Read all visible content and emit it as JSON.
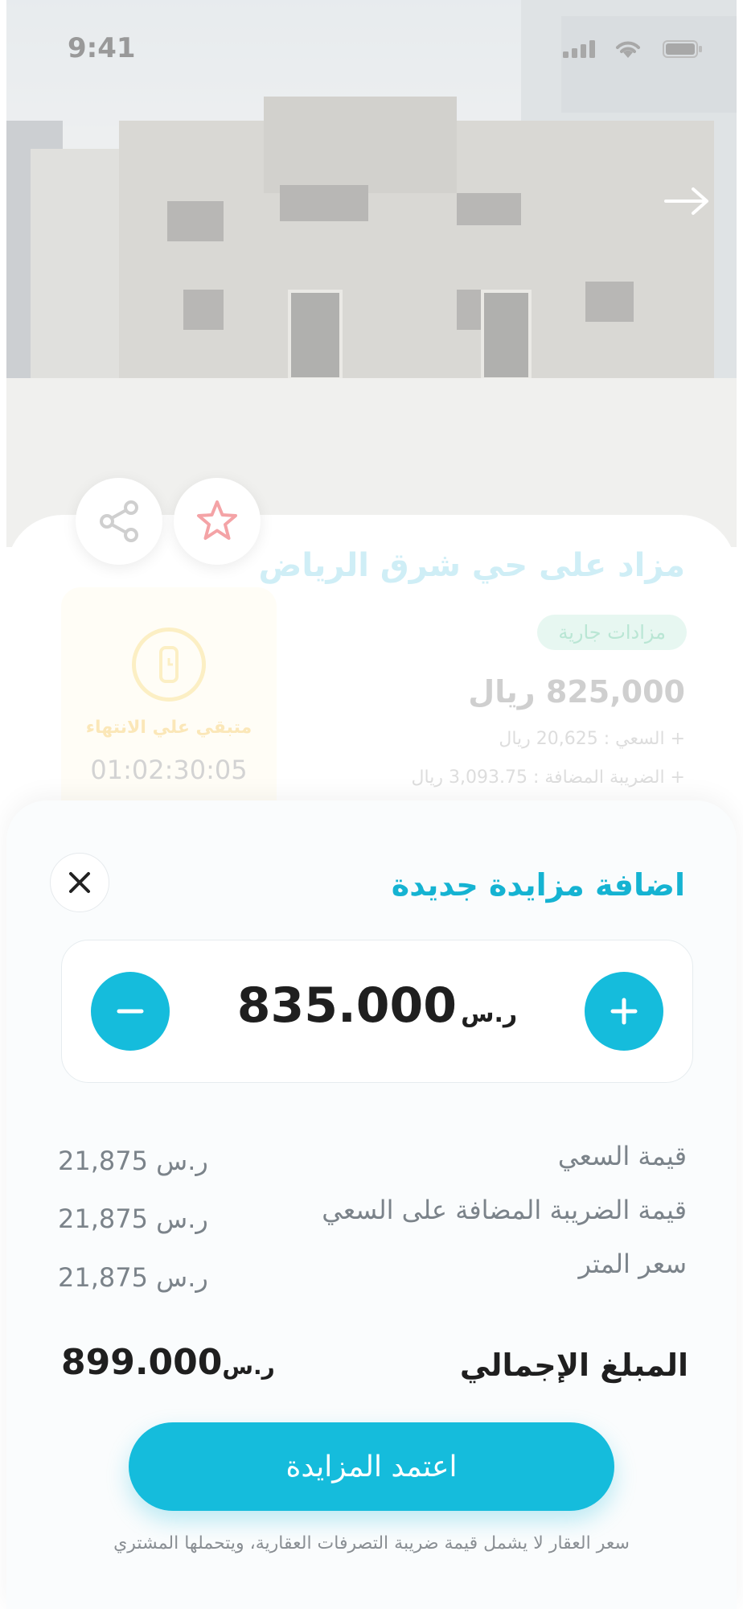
{
  "status_bar": {
    "time": "9:41"
  },
  "listing": {
    "title": "مزاد على حي شرق الرياض",
    "status": "مزادات جارية",
    "price": "825,000 ريال",
    "commission": "+ السعي : 20,625 ريال",
    "vat": "+ الضريبة المضافة : 3,093.75 ريال",
    "timer_label": "متبقي علي الانتهاء",
    "timer_value": "01:02:30:05"
  },
  "sheet": {
    "title": "اضافة مزايدة جديدة",
    "amount": "835.000",
    "currency": "ر.س",
    "rows": [
      {
        "label": "قيمة السعي",
        "value": "21,875 ر.س"
      },
      {
        "label": "قيمة الضريبة المضافة على السعي",
        "value": "21,875 ر.س"
      },
      {
        "label": "سعر المتر",
        "value": "21,875 ر.س"
      }
    ],
    "total_label": "المبلغ الإجمالي",
    "total_value": "899.000",
    "total_currency": "ر.س",
    "confirm_label": "اعتمد المزايدة",
    "footnote": "سعر العقار لا يشمل قيمة ضريبة التصرفات العقارية، ويتحملها المشتري"
  },
  "icons": {
    "back": "arrow-right-icon",
    "share": "share-icon",
    "favorite": "star-icon",
    "timer": "watch-icon",
    "close": "close-icon",
    "minus": "minus-icon",
    "plus": "plus-icon"
  },
  "colors": {
    "accent": "#15bcdc",
    "title_accent": "#15b3d2",
    "favorite": "#f4a3a6",
    "text_dark": "#1f1f1f",
    "text_muted": "#7b838a"
  }
}
